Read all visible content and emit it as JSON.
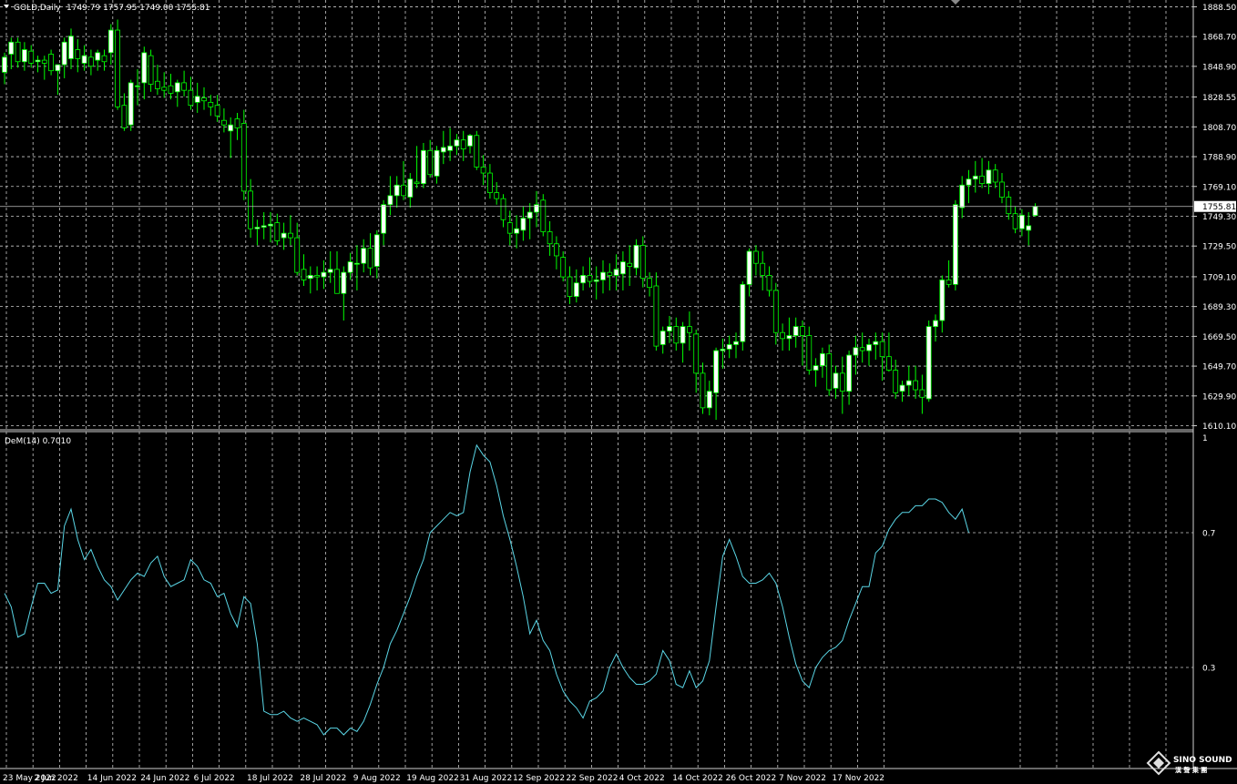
{
  "colors": {
    "background": "#000000",
    "grid": "#c8c8c8",
    "bull_candle": "#ffffff",
    "bear_candle": "#000000",
    "candle_outline": "#00ff00",
    "dem_line": "#5ad6e6",
    "price_line": "#c0c0c0"
  },
  "header": {
    "symbol": "GOLD,Daily",
    "ohlc": "1749.79 1757.95 1749.00 1755.81"
  },
  "indicator": {
    "label": "DeM(14) 0.7010"
  },
  "price_axis": {
    "ticks": [
      "1888.50",
      "1868.70",
      "1848.90",
      "1828.55",
      "1808.70",
      "1788.90",
      "1769.10",
      "1749.30",
      "1729.50",
      "1709.10",
      "1689.30",
      "1669.50",
      "1649.70",
      "1629.90",
      "1610.10"
    ],
    "current": "1755.81"
  },
  "indicator_axis": {
    "ticks": [
      "1",
      "0.7",
      "0.3"
    ]
  },
  "date_axis": {
    "labels": [
      "23 May 2022",
      "2 Jun 2022",
      "14 Jun 2022",
      "24 Jun 2022",
      "6 Jul 2022",
      "18 Jul 2022",
      "28 Jul 2022",
      "9 Aug 2022",
      "19 Aug 2022",
      "31 Aug 2022",
      "12 Sep 2022",
      "22 Sep 2022",
      "4 Oct 2022",
      "14 Oct 2022",
      "26 Oct 2022",
      "7 Nov 2022",
      "17 Nov 2022"
    ]
  },
  "logo": {
    "brand": "SINO SOUND",
    "subtitle": "漢 聲 集 團"
  },
  "chart_data": [
    {
      "type": "candlestick",
      "title": "GOLD,Daily",
      "ylim": [
        1608,
        1893
      ],
      "grid": true,
      "ohlc": [
        [
          1845,
          1858,
          1837,
          1855
        ],
        [
          1857,
          1868,
          1847,
          1865
        ],
        [
          1865,
          1868,
          1848,
          1852
        ],
        [
          1852,
          1865,
          1846,
          1860
        ],
        [
          1859,
          1863,
          1848,
          1851
        ],
        [
          1852,
          1856,
          1845,
          1853
        ],
        [
          1853,
          1856,
          1840,
          1851
        ],
        [
          1857,
          1860,
          1843,
          1846
        ],
        [
          1846,
          1850,
          1830,
          1850
        ],
        [
          1850,
          1868,
          1841,
          1865
        ],
        [
          1854,
          1874,
          1847,
          1869
        ],
        [
          1860,
          1867,
          1845,
          1854
        ],
        [
          1851,
          1863,
          1846,
          1856
        ],
        [
          1855,
          1860,
          1843,
          1849
        ],
        [
          1853,
          1860,
          1846,
          1858
        ],
        [
          1856,
          1860,
          1846,
          1852
        ],
        [
          1858,
          1877,
          1850,
          1873
        ],
        [
          1873,
          1880,
          1820,
          1822
        ],
        [
          1823,
          1831,
          1806,
          1808
        ],
        [
          1810,
          1840,
          1806,
          1838
        ],
        [
          1836,
          1847,
          1823,
          1836
        ],
        [
          1838,
          1862,
          1827,
          1858
        ],
        [
          1856,
          1860,
          1832,
          1837
        ],
        [
          1839,
          1850,
          1830,
          1834
        ],
        [
          1835,
          1845,
          1828,
          1833
        ],
        [
          1836,
          1844,
          1827,
          1831
        ],
        [
          1832,
          1840,
          1822,
          1838
        ],
        [
          1838,
          1846,
          1829,
          1833
        ],
        [
          1833,
          1842,
          1820,
          1823
        ],
        [
          1825,
          1838,
          1818,
          1829
        ],
        [
          1828,
          1835,
          1820,
          1826
        ],
        [
          1825,
          1830,
          1816,
          1822
        ],
        [
          1823,
          1830,
          1812,
          1816
        ],
        [
          1813,
          1821,
          1805,
          1810
        ],
        [
          1806,
          1815,
          1788,
          1810
        ],
        [
          1814,
          1818,
          1800,
          1808
        ],
        [
          1811,
          1820,
          1760,
          1766
        ],
        [
          1766,
          1774,
          1735,
          1741
        ],
        [
          1741,
          1747,
          1730,
          1742
        ],
        [
          1742,
          1752,
          1734,
          1743
        ],
        [
          1743,
          1752,
          1732,
          1744
        ],
        [
          1745,
          1751,
          1730,
          1733
        ],
        [
          1735,
          1745,
          1727,
          1738
        ],
        [
          1738,
          1750,
          1730,
          1735
        ],
        [
          1735,
          1745,
          1710,
          1712
        ],
        [
          1714,
          1724,
          1703,
          1707
        ],
        [
          1708,
          1716,
          1698,
          1710
        ],
        [
          1710,
          1716,
          1700,
          1709
        ],
        [
          1709,
          1720,
          1701,
          1712
        ],
        [
          1712,
          1726,
          1705,
          1714
        ],
        [
          1714,
          1726,
          1703,
          1698
        ],
        [
          1698,
          1716,
          1680,
          1712
        ],
        [
          1712,
          1725,
          1707,
          1719
        ],
        [
          1718,
          1730,
          1700,
          1718
        ],
        [
          1718,
          1734,
          1712,
          1728
        ],
        [
          1728,
          1738,
          1710,
          1715
        ],
        [
          1716,
          1740,
          1708,
          1737
        ],
        [
          1738,
          1760,
          1730,
          1757
        ],
        [
          1757,
          1776,
          1750,
          1763
        ],
        [
          1763,
          1776,
          1755,
          1770
        ],
        [
          1770,
          1786,
          1760,
          1763
        ],
        [
          1762,
          1778,
          1755,
          1774
        ],
        [
          1772,
          1796,
          1768,
          1771
        ],
        [
          1771,
          1798,
          1768,
          1793
        ],
        [
          1793,
          1800,
          1775,
          1777
        ],
        [
          1776,
          1796,
          1771,
          1793
        ],
        [
          1792,
          1806,
          1784,
          1795
        ],
        [
          1793,
          1808,
          1786,
          1796
        ],
        [
          1796,
          1804,
          1790,
          1800
        ],
        [
          1800,
          1806,
          1786,
          1794
        ],
        [
          1796,
          1804,
          1791,
          1803
        ],
        [
          1803,
          1806,
          1780,
          1782
        ],
        [
          1782,
          1790,
          1770,
          1778
        ],
        [
          1778,
          1784,
          1761,
          1765
        ],
        [
          1765,
          1772,
          1757,
          1761
        ],
        [
          1761,
          1764,
          1742,
          1747
        ],
        [
          1745,
          1753,
          1730,
          1738
        ],
        [
          1738,
          1750,
          1728,
          1741
        ],
        [
          1740,
          1756,
          1733,
          1748
        ],
        [
          1748,
          1758,
          1734,
          1752
        ],
        [
          1752,
          1766,
          1742,
          1757
        ],
        [
          1760,
          1764,
          1736,
          1739
        ],
        [
          1739,
          1746,
          1723,
          1731
        ],
        [
          1731,
          1736,
          1714,
          1723
        ],
        [
          1722,
          1726,
          1706,
          1709
        ],
        [
          1709,
          1716,
          1691,
          1696
        ],
        [
          1696,
          1714,
          1692,
          1705
        ],
        [
          1705,
          1716,
          1700,
          1710
        ],
        [
          1710,
          1722,
          1702,
          1706
        ],
        [
          1706,
          1716,
          1694,
          1707
        ],
        [
          1707,
          1720,
          1698,
          1712
        ],
        [
          1712,
          1718,
          1700,
          1710
        ],
        [
          1710,
          1724,
          1700,
          1714
        ],
        [
          1711,
          1726,
          1700,
          1719
        ],
        [
          1718,
          1730,
          1703,
          1716
        ],
        [
          1715,
          1734,
          1710,
          1730
        ],
        [
          1730,
          1736,
          1702,
          1708
        ],
        [
          1708,
          1712,
          1696,
          1702
        ],
        [
          1703,
          1712,
          1660,
          1663
        ],
        [
          1664,
          1676,
          1658,
          1673
        ],
        [
          1673,
          1683,
          1665,
          1676
        ],
        [
          1676,
          1682,
          1660,
          1665
        ],
        [
          1665,
          1679,
          1652,
          1676
        ],
        [
          1676,
          1686,
          1660,
          1672
        ],
        [
          1671,
          1674,
          1632,
          1645
        ],
        [
          1645,
          1652,
          1618,
          1622
        ],
        [
          1622,
          1640,
          1617,
          1633
        ],
        [
          1632,
          1662,
          1614,
          1660
        ],
        [
          1660,
          1668,
          1648,
          1661
        ],
        [
          1661,
          1670,
          1655,
          1664
        ],
        [
          1664,
          1672,
          1655,
          1666
        ],
        [
          1666,
          1706,
          1660,
          1704
        ],
        [
          1704,
          1728,
          1696,
          1726
        ],
        [
          1726,
          1730,
          1710,
          1718
        ],
        [
          1718,
          1726,
          1700,
          1710
        ],
        [
          1710,
          1716,
          1696,
          1700
        ],
        [
          1700,
          1705,
          1664,
          1672
        ],
        [
          1672,
          1678,
          1660,
          1668
        ],
        [
          1668,
          1682,
          1660,
          1670
        ],
        [
          1670,
          1682,
          1662,
          1676
        ],
        [
          1676,
          1680,
          1650,
          1670
        ],
        [
          1670,
          1676,
          1644,
          1647
        ],
        [
          1647,
          1655,
          1636,
          1650
        ],
        [
          1650,
          1662,
          1642,
          1658
        ],
        [
          1658,
          1664,
          1630,
          1634
        ],
        [
          1635,
          1650,
          1628,
          1645
        ],
        [
          1645,
          1656,
          1618,
          1633
        ],
        [
          1633,
          1660,
          1624,
          1657
        ],
        [
          1657,
          1670,
          1644,
          1662
        ],
        [
          1662,
          1672,
          1652,
          1660
        ],
        [
          1660,
          1668,
          1650,
          1664
        ],
        [
          1664,
          1672,
          1654,
          1666
        ],
        [
          1666,
          1672,
          1640,
          1656
        ],
        [
          1656,
          1672,
          1646,
          1647
        ],
        [
          1647,
          1654,
          1628,
          1632
        ],
        [
          1633,
          1640,
          1626,
          1637
        ],
        [
          1637,
          1650,
          1630,
          1640
        ],
        [
          1640,
          1650,
          1628,
          1634
        ],
        [
          1634,
          1644,
          1618,
          1629
        ],
        [
          1628,
          1680,
          1626,
          1676
        ],
        [
          1676,
          1684,
          1666,
          1680
        ],
        [
          1680,
          1710,
          1672,
          1707
        ],
        [
          1707,
          1720,
          1702,
          1704
        ],
        [
          1704,
          1760,
          1700,
          1757
        ],
        [
          1755,
          1776,
          1748,
          1770
        ],
        [
          1770,
          1780,
          1758,
          1774
        ],
        [
          1774,
          1786,
          1765,
          1776
        ],
        [
          1776,
          1788,
          1768,
          1771
        ],
        [
          1771,
          1786,
          1764,
          1780
        ],
        [
          1780,
          1784,
          1768,
          1772
        ],
        [
          1772,
          1778,
          1758,
          1762
        ],
        [
          1762,
          1766,
          1747,
          1751
        ],
        [
          1751,
          1756,
          1738,
          1741
        ],
        [
          1741,
          1754,
          1736,
          1750
        ],
        [
          1740,
          1752,
          1730,
          1743
        ],
        [
          1749.79,
          1757.95,
          1749.0,
          1755.81
        ]
      ]
    },
    {
      "type": "line",
      "title": "DeM(14) 0.7010",
      "ylim": [
        0,
        1
      ],
      "grid": true,
      "values": [
        0.52,
        0.48,
        0.39,
        0.4,
        0.48,
        0.55,
        0.55,
        0.52,
        0.53,
        0.72,
        0.77,
        0.68,
        0.62,
        0.65,
        0.6,
        0.56,
        0.54,
        0.5,
        0.53,
        0.56,
        0.58,
        0.57,
        0.61,
        0.63,
        0.57,
        0.54,
        0.55,
        0.56,
        0.62,
        0.6,
        0.56,
        0.55,
        0.51,
        0.52,
        0.46,
        0.42,
        0.51,
        0.49,
        0.37,
        0.17,
        0.16,
        0.16,
        0.17,
        0.15,
        0.14,
        0.15,
        0.14,
        0.13,
        0.1,
        0.12,
        0.12,
        0.1,
        0.12,
        0.11,
        0.14,
        0.19,
        0.25,
        0.3,
        0.37,
        0.41,
        0.46,
        0.51,
        0.57,
        0.62,
        0.7,
        0.72,
        0.74,
        0.76,
        0.75,
        0.76,
        0.88,
        0.96,
        0.93,
        0.91,
        0.84,
        0.75,
        0.68,
        0.6,
        0.51,
        0.4,
        0.44,
        0.38,
        0.35,
        0.28,
        0.23,
        0.2,
        0.18,
        0.15,
        0.2,
        0.21,
        0.23,
        0.3,
        0.34,
        0.3,
        0.27,
        0.25,
        0.25,
        0.26,
        0.28,
        0.35,
        0.32,
        0.25,
        0.24,
        0.29,
        0.24,
        0.26,
        0.32,
        0.48,
        0.63,
        0.68,
        0.63,
        0.57,
        0.55,
        0.55,
        0.56,
        0.58,
        0.55,
        0.48,
        0.39,
        0.31,
        0.26,
        0.24,
        0.3,
        0.33,
        0.35,
        0.36,
        0.38,
        0.44,
        0.49,
        0.54,
        0.54,
        0.64,
        0.66,
        0.71,
        0.74,
        0.76,
        0.76,
        0.78,
        0.78,
        0.8,
        0.8,
        0.79,
        0.76,
        0.74,
        0.77,
        0.7
      ]
    }
  ]
}
